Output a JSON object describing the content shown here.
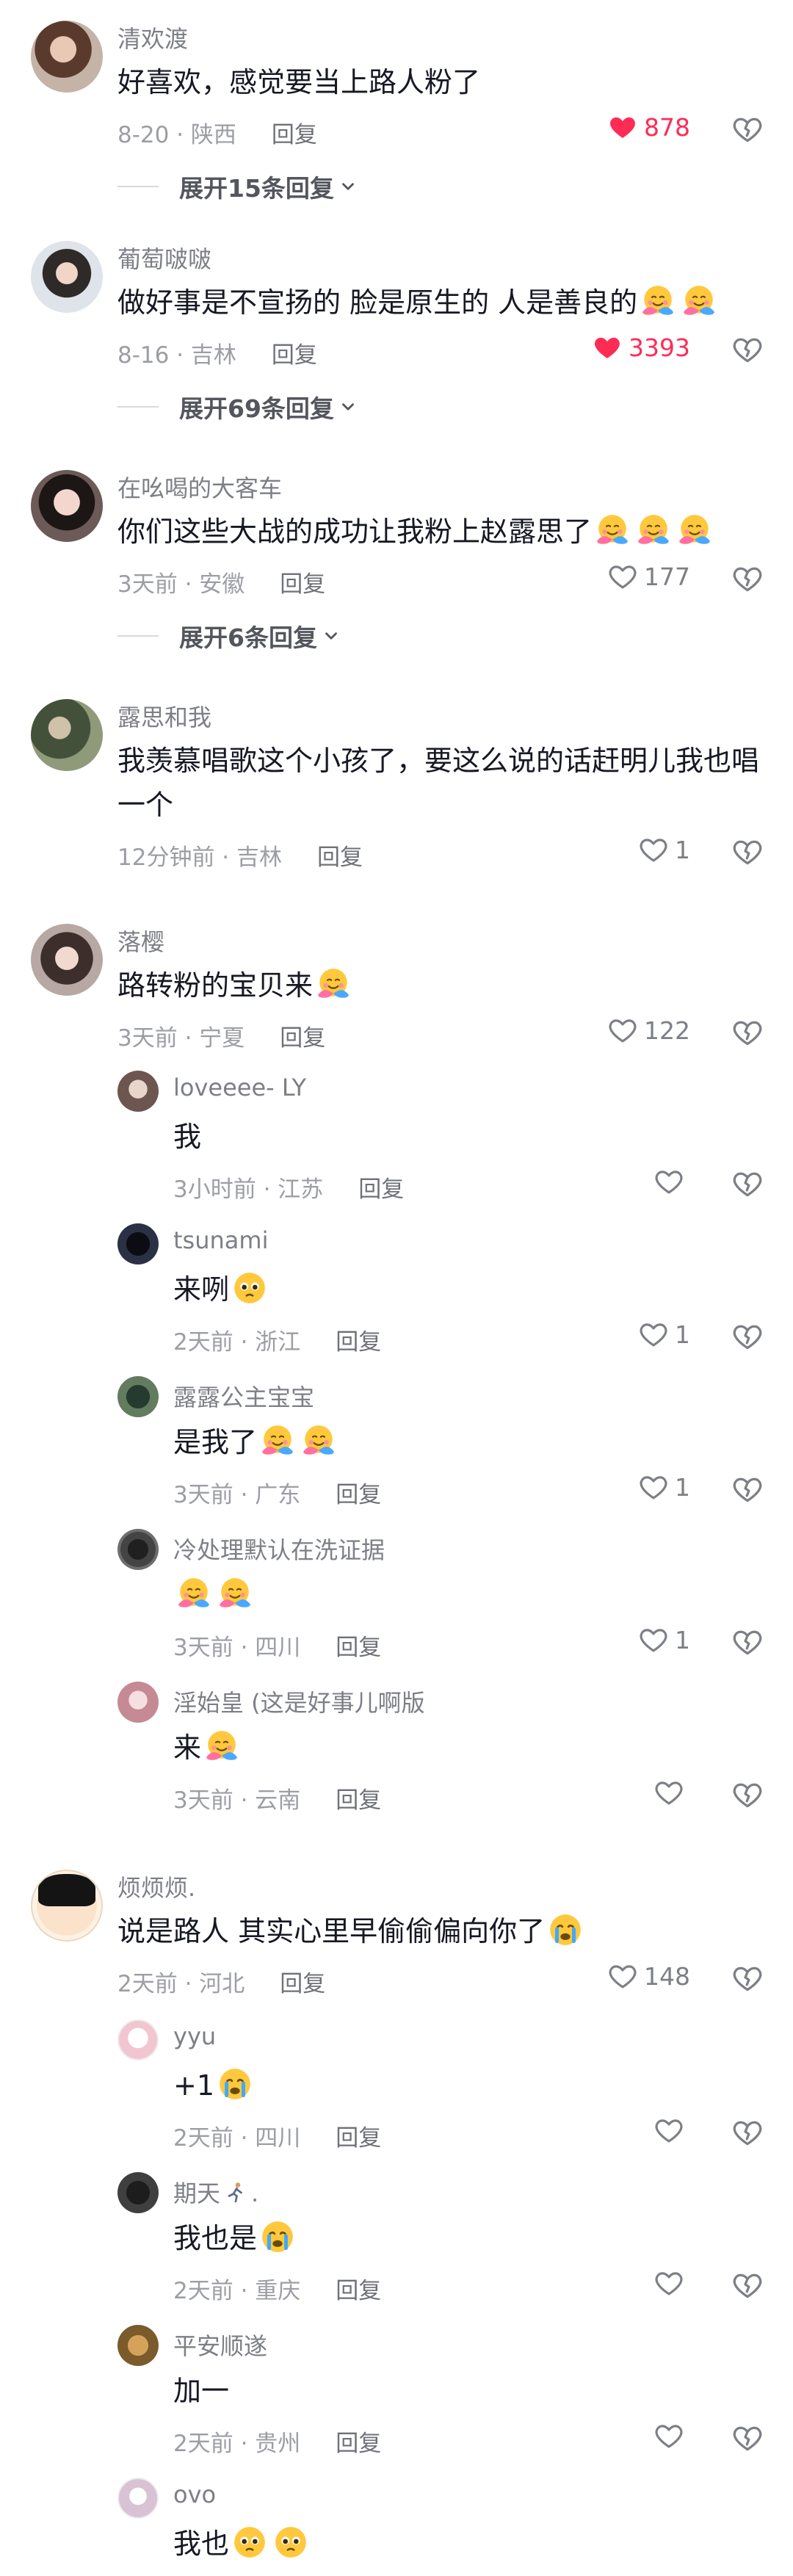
{
  "colors": {
    "like_active": "#fe2c55",
    "text": "#161823",
    "muted": "#9c9ea4"
  },
  "icons": {
    "like": "heart-icon",
    "dislike": "broken-heart-icon",
    "expand": "chevron-down-icon",
    "hug": "hug-emoji",
    "cry": "loudly-crying-emoji",
    "plead": "pleading-emoji",
    "runner": "running-emoji"
  },
  "comments": [
    {
      "user": "清欢渡",
      "text": "好喜欢，感觉要当上路人粉了",
      "time": "8-20 · 陕西",
      "reply": "回复",
      "likes": "878",
      "liked": true,
      "expand": "展开15条回复"
    },
    {
      "user": "葡萄啵啵",
      "text": "做好事是不宣扬的 脸是原生的 人是善良的",
      "time": "8-16 · 吉林",
      "reply": "回复",
      "likes": "3393",
      "liked": true,
      "expand": "展开69条回复"
    },
    {
      "user": "在吆喝的大客车",
      "text": "你们这些大战的成功让我粉上赵露思了",
      "time": "3天前 · 安徽",
      "reply": "回复",
      "likes": "177",
      "expand": "展开6条回复"
    },
    {
      "user": "露思和我",
      "text": "我羡慕唱歌这个小孩了，要这么说的话赶明儿我也唱一个",
      "time": "12分钟前 · 吉林",
      "reply": "回复",
      "likes": "1"
    },
    {
      "user": "落樱",
      "text": "路转粉的宝贝来",
      "time": "3天前 · 宁夏",
      "reply": "回复",
      "likes": "122"
    },
    {
      "user": "loveeee- LY",
      "text": "我",
      "time": "3小时前 · 江苏",
      "reply": "回复",
      "likes": ""
    },
    {
      "user": "tsunami",
      "text": "来咧",
      "time": "2天前 · 浙江",
      "reply": "回复",
      "likes": "1"
    },
    {
      "user": "露露公主宝宝",
      "text": "是我了",
      "time": "3天前 · 广东",
      "reply": "回复",
      "likes": "1"
    },
    {
      "user": "冷处理默认在洗证据",
      "text": "",
      "time": "3天前 · 四川",
      "reply": "回复",
      "likes": "1"
    },
    {
      "user": "淫始皇 (这是好事儿啊版",
      "text": "来",
      "time": "3天前 · 云南",
      "reply": "回复",
      "likes": ""
    },
    {
      "user": "烦烦烦.",
      "text": "说是路人 其实心里早偷偷偏向你了",
      "time": "2天前 · 河北",
      "reply": "回复",
      "likes": "148"
    },
    {
      "user": "yyu",
      "text": "+1",
      "time": "2天前 · 四川",
      "reply": "回复",
      "likes": ""
    },
    {
      "user": "期天",
      "text": "我也是",
      "time": "2天前 · 重庆",
      "reply": "回复",
      "likes": ""
    },
    {
      "user": "平安顺遂",
      "text": "加一",
      "time": "2天前 · 贵州",
      "reply": "回复",
      "likes": ""
    },
    {
      "user": "ovo",
      "text": "我也",
      "time": "",
      "reply": "",
      "likes": ""
    }
  ]
}
